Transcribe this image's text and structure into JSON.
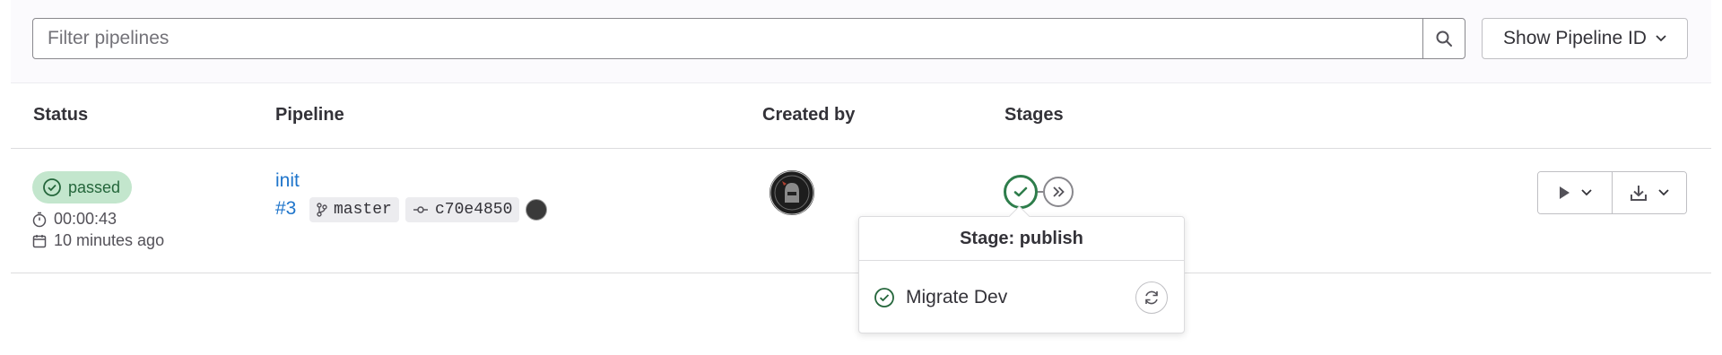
{
  "filter": {
    "placeholder": "Filter pipelines"
  },
  "pipeline_id_button": {
    "label": "Show Pipeline ID"
  },
  "table": {
    "headers": {
      "status": "Status",
      "pipeline": "Pipeline",
      "created_by": "Created by",
      "stages": "Stages"
    }
  },
  "row": {
    "status": "passed",
    "duration": "00:00:43",
    "finished": "10 minutes ago",
    "title": "init",
    "id": "#3",
    "branch": "master",
    "commit": "c70e4850"
  },
  "popover": {
    "title": "Stage: publish",
    "job": "Migrate Dev"
  },
  "colors": {
    "success": "#24663b",
    "success_bg": "#c3e6cd",
    "link": "#1f75cb"
  },
  "icons": [
    "search-icon",
    "chevron-down-icon",
    "clock-icon",
    "calendar-icon",
    "branch-icon",
    "commit-icon",
    "status-success-icon",
    "skip-forward-icon",
    "play-icon",
    "download-icon",
    "retry-icon"
  ]
}
